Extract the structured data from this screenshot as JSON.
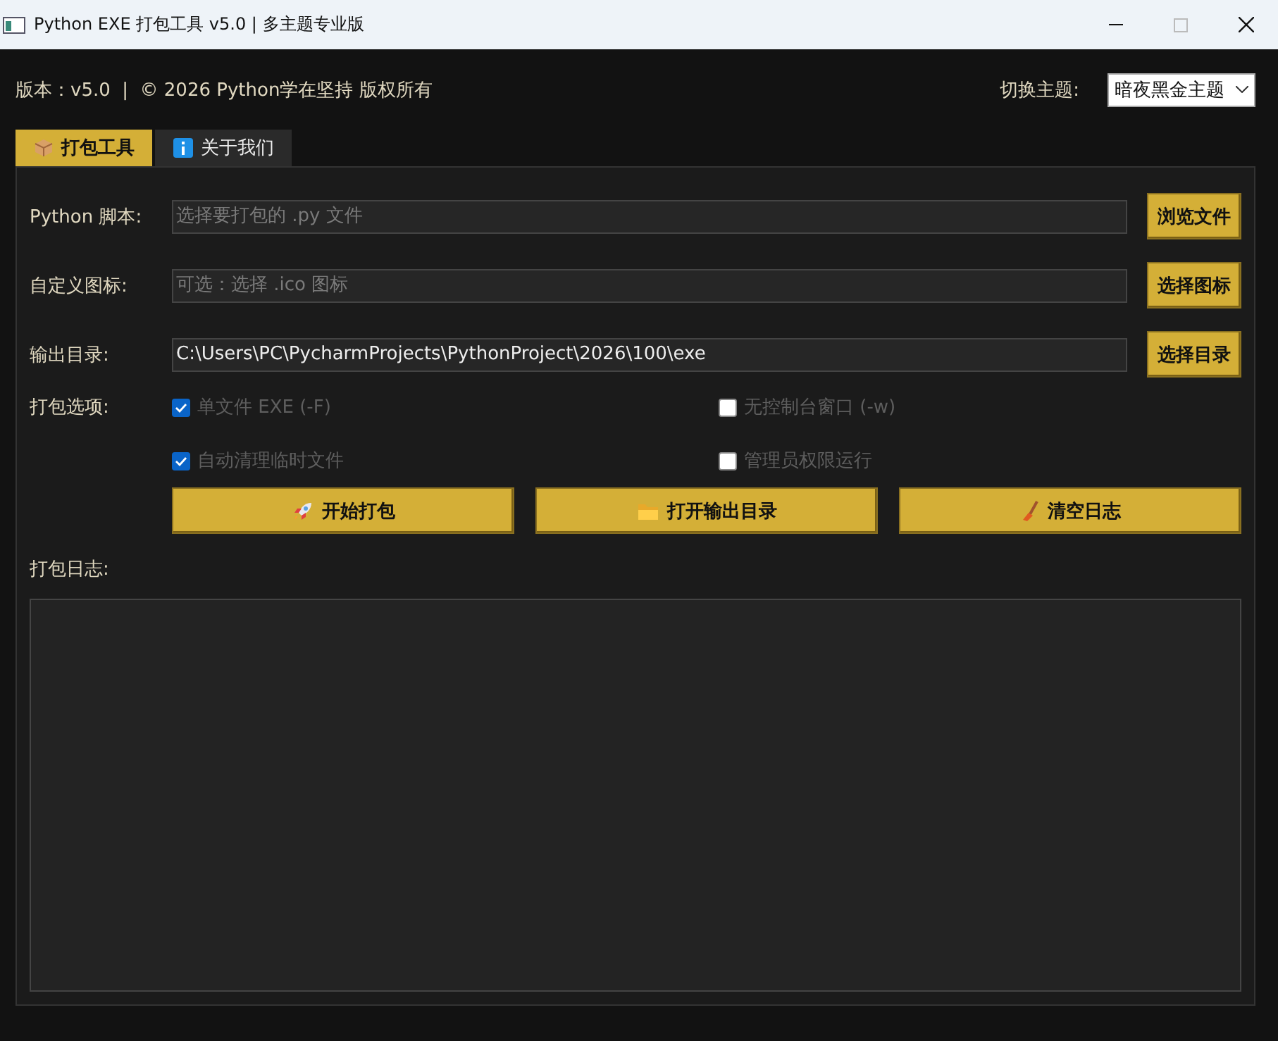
{
  "window": {
    "title": "Python EXE 打包工具 v5.0 | 多主题专业版"
  },
  "header": {
    "info": "版本：v5.0  |  © 2026 Python学在坚持 版权所有",
    "theme_label": "切换主题:",
    "theme_value": "暗夜黑金主题"
  },
  "tabs": [
    {
      "label": "打包工具",
      "kind": "box",
      "selected": true
    },
    {
      "label": "关于我们",
      "kind": "info",
      "selected": false
    }
  ],
  "fields": [
    {
      "label": "Python 脚本:",
      "placeholder": "选择要打包的 .py 文件",
      "button": "浏览文件"
    },
    {
      "label": "自定义图标:",
      "placeholder": "可选：选择 .ico 图标",
      "button": "选择图标"
    },
    {
      "label": "输出目录:",
      "value": "C:\\Users\\PC\\PycharmProjects\\PythonProject\\2026\\100\\exe",
      "button": "选择目录"
    }
  ],
  "options_label": "打包选项:",
  "options": [
    {
      "label": "单文件 EXE (-F)",
      "checked": true
    },
    {
      "label": "无控制台窗口 (-w)",
      "checked": false
    },
    {
      "label": "自动清理临时文件",
      "checked": true
    },
    {
      "label": "管理员权限运行",
      "checked": false
    }
  ],
  "actions": [
    {
      "label": "开始打包",
      "kind": "rocket"
    },
    {
      "label": "打开输出目录",
      "kind": "folder"
    },
    {
      "label": "清空日志",
      "kind": "broom"
    }
  ],
  "log_label": "打包日志:"
}
